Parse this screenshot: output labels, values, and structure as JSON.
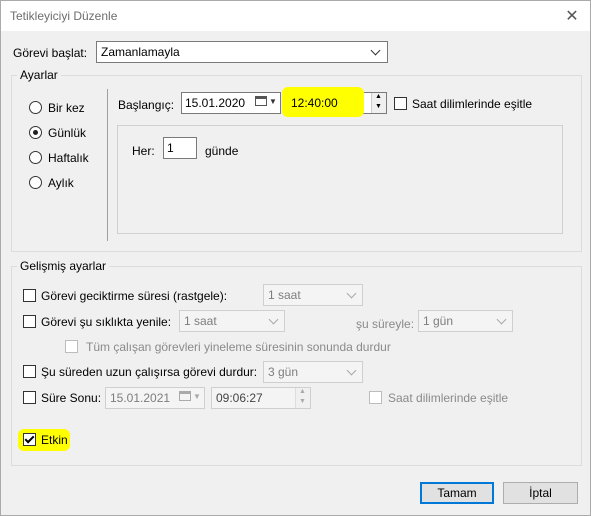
{
  "window": {
    "title": "Tetikleyiciyi Düzenle"
  },
  "start_task": {
    "label": "Görevi başlat:",
    "value": "Zamanlamayla"
  },
  "settings": {
    "legend": "Ayarlar",
    "radios": [
      "Bir kez",
      "Günlük",
      "Haftalık",
      "Aylık"
    ],
    "selected_radio": "Günlük",
    "start_label": "Başlangıç:",
    "start_date": "15.01.2020",
    "start_time": "12:40:00",
    "tz_sync_label": "Saat dilimlerinde eşitle",
    "every_label": "Her:",
    "every_value": "1",
    "every_unit": "günde"
  },
  "advanced": {
    "legend": "Gelişmiş ayarlar",
    "delay_label": "Görevi geciktirme süresi (rastgele):",
    "delay_value": "1 saat",
    "repeat_label": "Görevi şu sıklıkta yenile:",
    "repeat_value": "1 saat",
    "duration_label": "şu süreyle:",
    "duration_value": "1 gün",
    "stop_all_label": "Tüm çalışan görevleri yineleme süresinin sonunda durdur",
    "stop_longer_label": "Şu süreden uzun çalışırsa görevi durdur:",
    "stop_longer_value": "3 gün",
    "expire_label": "Süre Sonu:",
    "expire_date": "15.01.2021",
    "expire_time": "09:06:27",
    "expire_tz_label": "Saat dilimlerinde eşitle",
    "enabled_label": "Etkin",
    "enabled": true
  },
  "buttons": {
    "ok": "Tamam",
    "cancel": "İptal"
  },
  "colors": {
    "highlight": "#ffff00",
    "focus": "#0078d7"
  }
}
